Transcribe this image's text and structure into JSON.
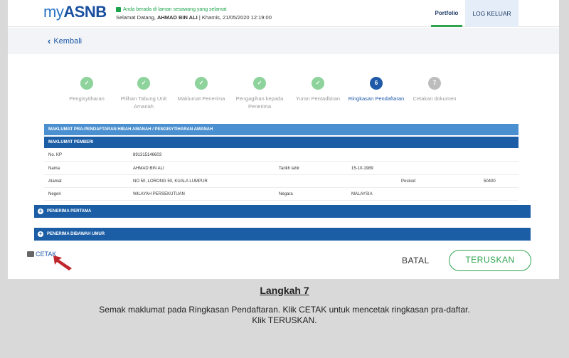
{
  "header": {
    "logo_my": "my",
    "logo_asnb": "ASNB",
    "secure_notice": "Anda berada di laman sesawang yang selamat",
    "welcome_prefix": "Selamat Datang, ",
    "user_name": "AHMAD BIN ALI",
    "welcome_suffix": " | Khamis, 21/05/2020 12:19:00",
    "nav_portfolio": "Portfolio",
    "nav_logout": "LOG KELUAR"
  },
  "back_label": "Kembali",
  "steps": [
    {
      "num": "",
      "label": "Pengisytiharan",
      "state": "done"
    },
    {
      "num": "",
      "label": "Pilihan Tabung Unit Amanah",
      "state": "done"
    },
    {
      "num": "",
      "label": "Maklumat Penerima",
      "state": "done"
    },
    {
      "num": "",
      "label": "Pengagihan kepada Penerima",
      "state": "done"
    },
    {
      "num": "",
      "label": "Yuran Pentadbiran",
      "state": "done"
    },
    {
      "num": "6",
      "label": "Ringkasan Pendaftaran",
      "state": "active"
    },
    {
      "num": "7",
      "label": "Cetakan dokumen",
      "state": "todo"
    }
  ],
  "summary": {
    "main_header": "MAKLUMAT PRA-PENDAFTARAN HIBAH AMANAH / PENGISYTIHARAN AMANAH",
    "section_header": "MAKLUMAT PEMBERI",
    "rows": {
      "nokp_label": "No. KP",
      "nokp_value": "891315146603",
      "nama_label": "Nama",
      "nama_value": "AHMAD BIN ALI",
      "tarikh_label": "Tarikh lahir",
      "tarikh_value": "15-10-1989",
      "alamat_label": "Alamat",
      "alamat_value": "NO 50, LORONG 50, KUALA LUMPUR",
      "poskod_label": "Poskod",
      "poskod_value": "50400",
      "negeri_label": "Negeri",
      "negeri_value": "WILAYAH PERSEKUTUAN",
      "negara_label": "Negara",
      "negara_value": "MALAYSIA"
    },
    "accordion_1": "PENERIMA PERTAMA",
    "accordion_2": "PENERIMA DIBAWAH UMUR"
  },
  "actions": {
    "cetak": "CETAK",
    "batal": "BATAL",
    "teruskan": "TERUSKAN"
  },
  "caption": {
    "title": "Langkah 7",
    "line1": "Semak maklumat pada Ringkasan Pendaftaran. Klik CETAK untuk mencetak ringkasan pra-daftar.",
    "line2": "Klik TERUSKAN."
  },
  "colors": {
    "brand_blue": "#1c5ea6",
    "light_blue": "#4a8fd0",
    "success_green": "#2ea44f",
    "done_green": "#8ed39c",
    "arrow_red": "#c0262d"
  }
}
